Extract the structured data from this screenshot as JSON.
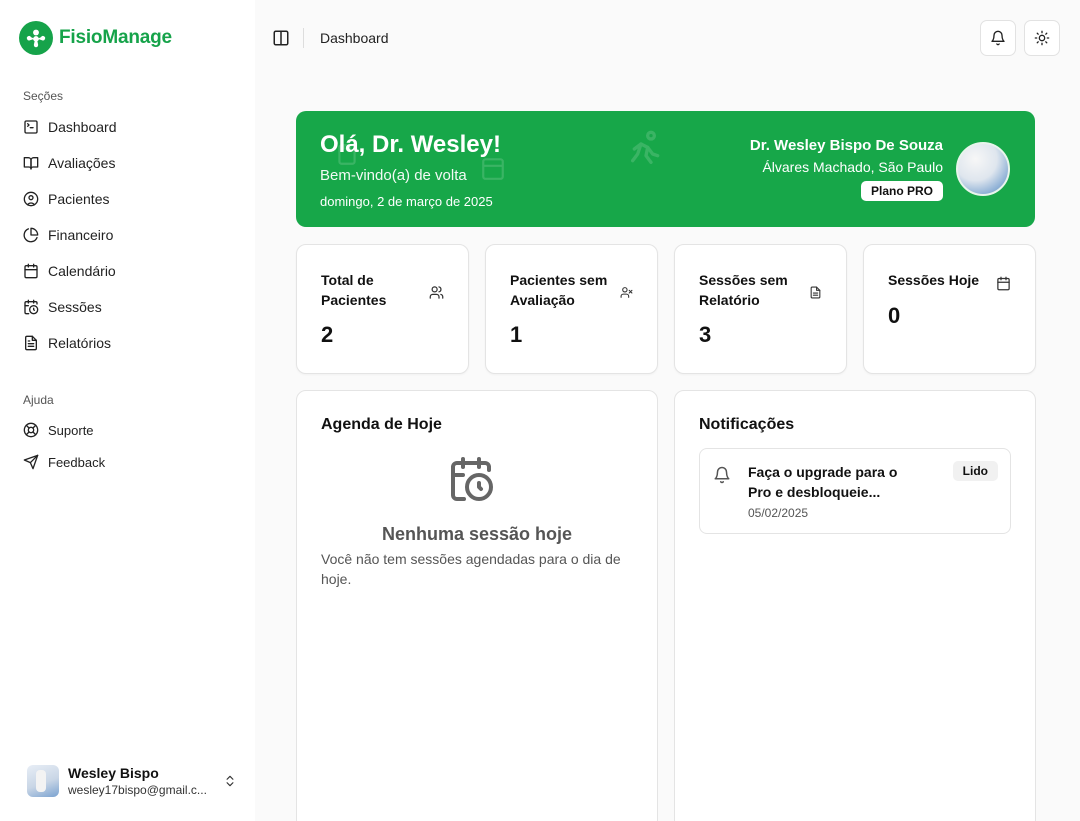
{
  "app": {
    "name": "FisioManage"
  },
  "sidebar": {
    "sections_label": "Seções",
    "items": [
      {
        "label": "Dashboard",
        "icon": "terminal-square-icon"
      },
      {
        "label": "Avaliações",
        "icon": "book-open-icon"
      },
      {
        "label": "Pacientes",
        "icon": "user-circle-icon"
      },
      {
        "label": "Financeiro",
        "icon": "pie-chart-icon"
      },
      {
        "label": "Calendário",
        "icon": "calendar-icon"
      },
      {
        "label": "Sessões",
        "icon": "calendar-clock-icon"
      },
      {
        "label": "Relatórios",
        "icon": "file-text-icon"
      }
    ],
    "help_label": "Ajuda",
    "help_items": [
      {
        "label": "Suporte",
        "icon": "life-buoy-icon"
      },
      {
        "label": "Feedback",
        "icon": "send-icon"
      }
    ],
    "user": {
      "name": "Wesley Bispo",
      "email": "wesley17bispo@gmail.c..."
    }
  },
  "header": {
    "breadcrumb": "Dashboard"
  },
  "hero": {
    "greeting": "Olá, Dr. Wesley!",
    "subtitle": "Bem-vindo(a) de volta",
    "date": "domingo, 2 de março de 2025",
    "doctor_name": "Dr. Wesley Bispo De Souza",
    "location": "Álvares Machado, São Paulo",
    "plan": "Plano PRO"
  },
  "stats": [
    {
      "label": "Total de Pacientes",
      "value": "2",
      "icon": "users-icon"
    },
    {
      "label": "Pacientes sem Avaliação",
      "value": "1",
      "icon": "user-x-icon"
    },
    {
      "label": "Sessões sem Relatório",
      "value": "3",
      "icon": "file-text-icon"
    },
    {
      "label": "Sessões Hoje",
      "value": "0",
      "icon": "calendar-icon"
    }
  ],
  "agenda": {
    "title": "Agenda de Hoje",
    "empty_title": "Nenhuma sessão hoje",
    "empty_text": "Você não tem sessões agendadas para o dia de hoje."
  },
  "notifications": {
    "title": "Notificações",
    "items": [
      {
        "text": "Faça o upgrade para o Pro e desbloqueie...",
        "date": "05/02/2025",
        "status": "Lido"
      }
    ]
  },
  "colors": {
    "brand": "#16a34a",
    "hero_bg": "#17a749"
  }
}
